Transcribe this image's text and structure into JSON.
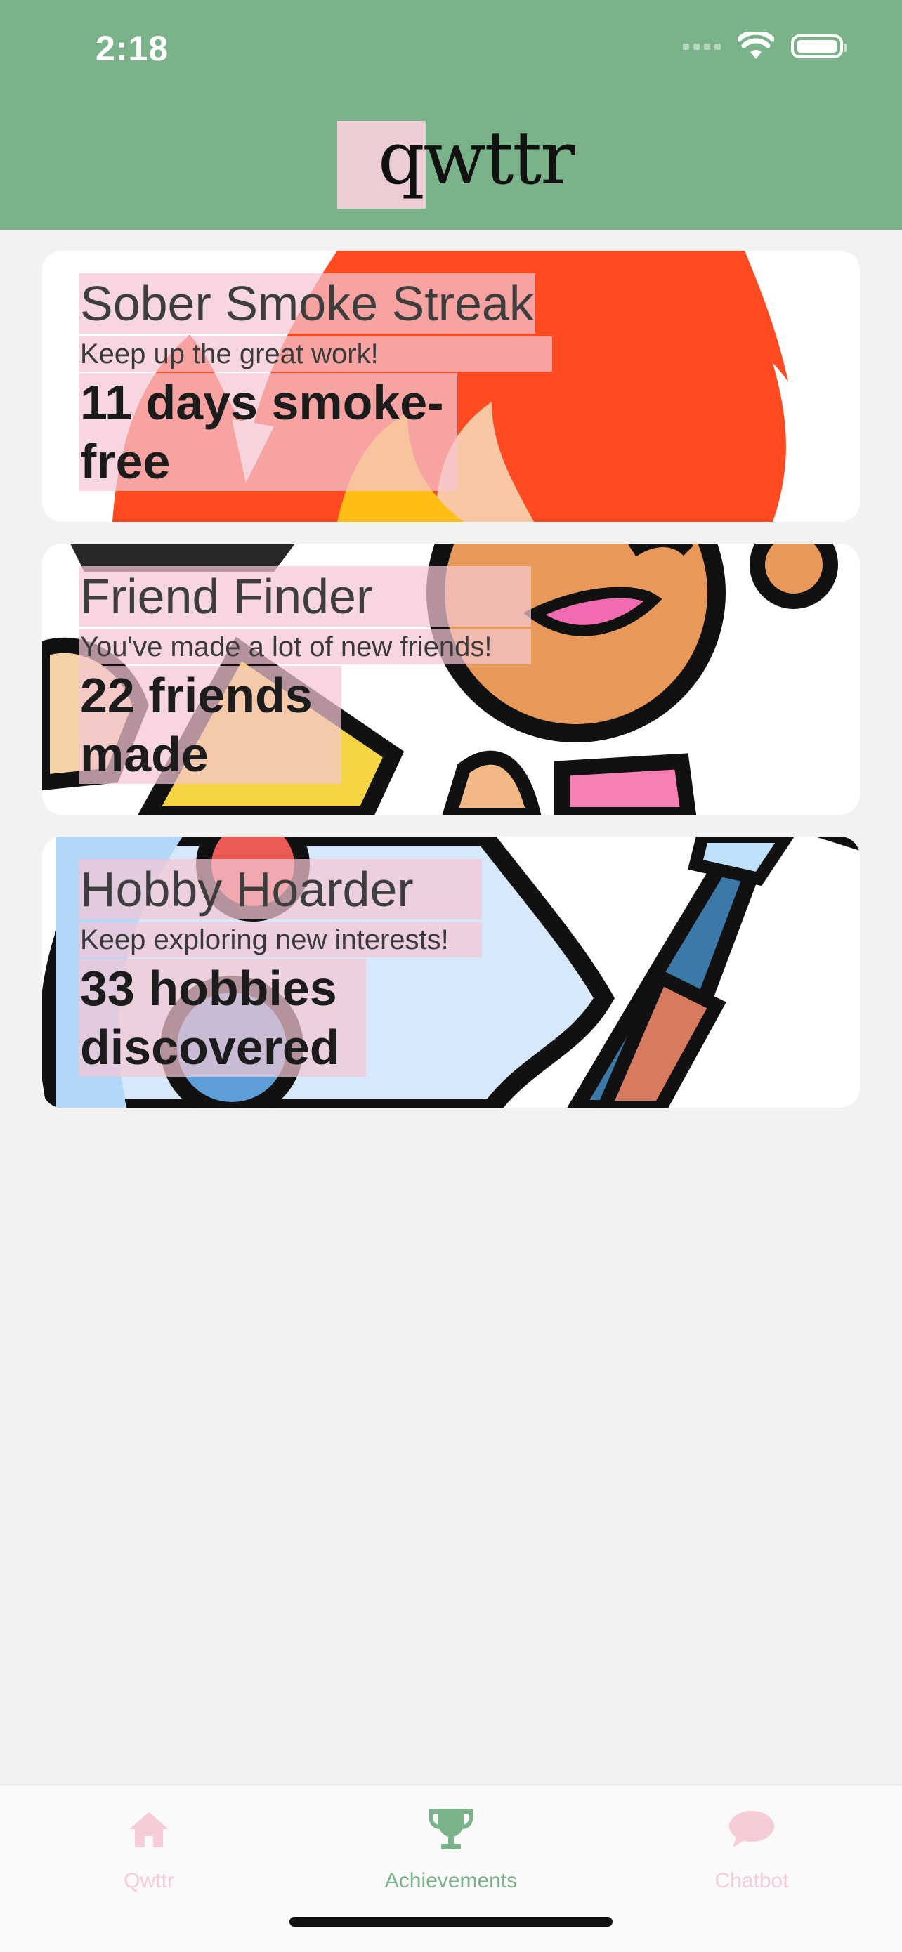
{
  "status_bar": {
    "time": "2:18"
  },
  "header": {
    "logo_text": "qwttr"
  },
  "cards": [
    {
      "title": "Sober Smoke Streak",
      "subtitle": "Keep up the great work!",
      "stat": "11 days smoke-free",
      "art_icon": "flame-icon"
    },
    {
      "title": "Friend Finder",
      "subtitle": "You've made a lot of new friends!",
      "stat": "22 friends made",
      "art_icon": "party-person-icon"
    },
    {
      "title": "Hobby Hoarder",
      "subtitle": "Keep exploring new interests!",
      "stat": "33 hobbies discovered",
      "art_icon": "paint-palette-icon"
    }
  ],
  "tabbar": {
    "tabs": [
      {
        "label": "Qwttr",
        "icon": "home-icon",
        "active": false
      },
      {
        "label": "Achievements",
        "icon": "trophy-icon",
        "active": true
      },
      {
        "label": "Chatbot",
        "icon": "chat-bubble-icon",
        "active": false
      }
    ]
  },
  "colors": {
    "header": "#7ab28a",
    "active_tab": "#7ab28a",
    "inactive_tab": "#f6ccd6",
    "highlight": "#f4c6d2"
  }
}
